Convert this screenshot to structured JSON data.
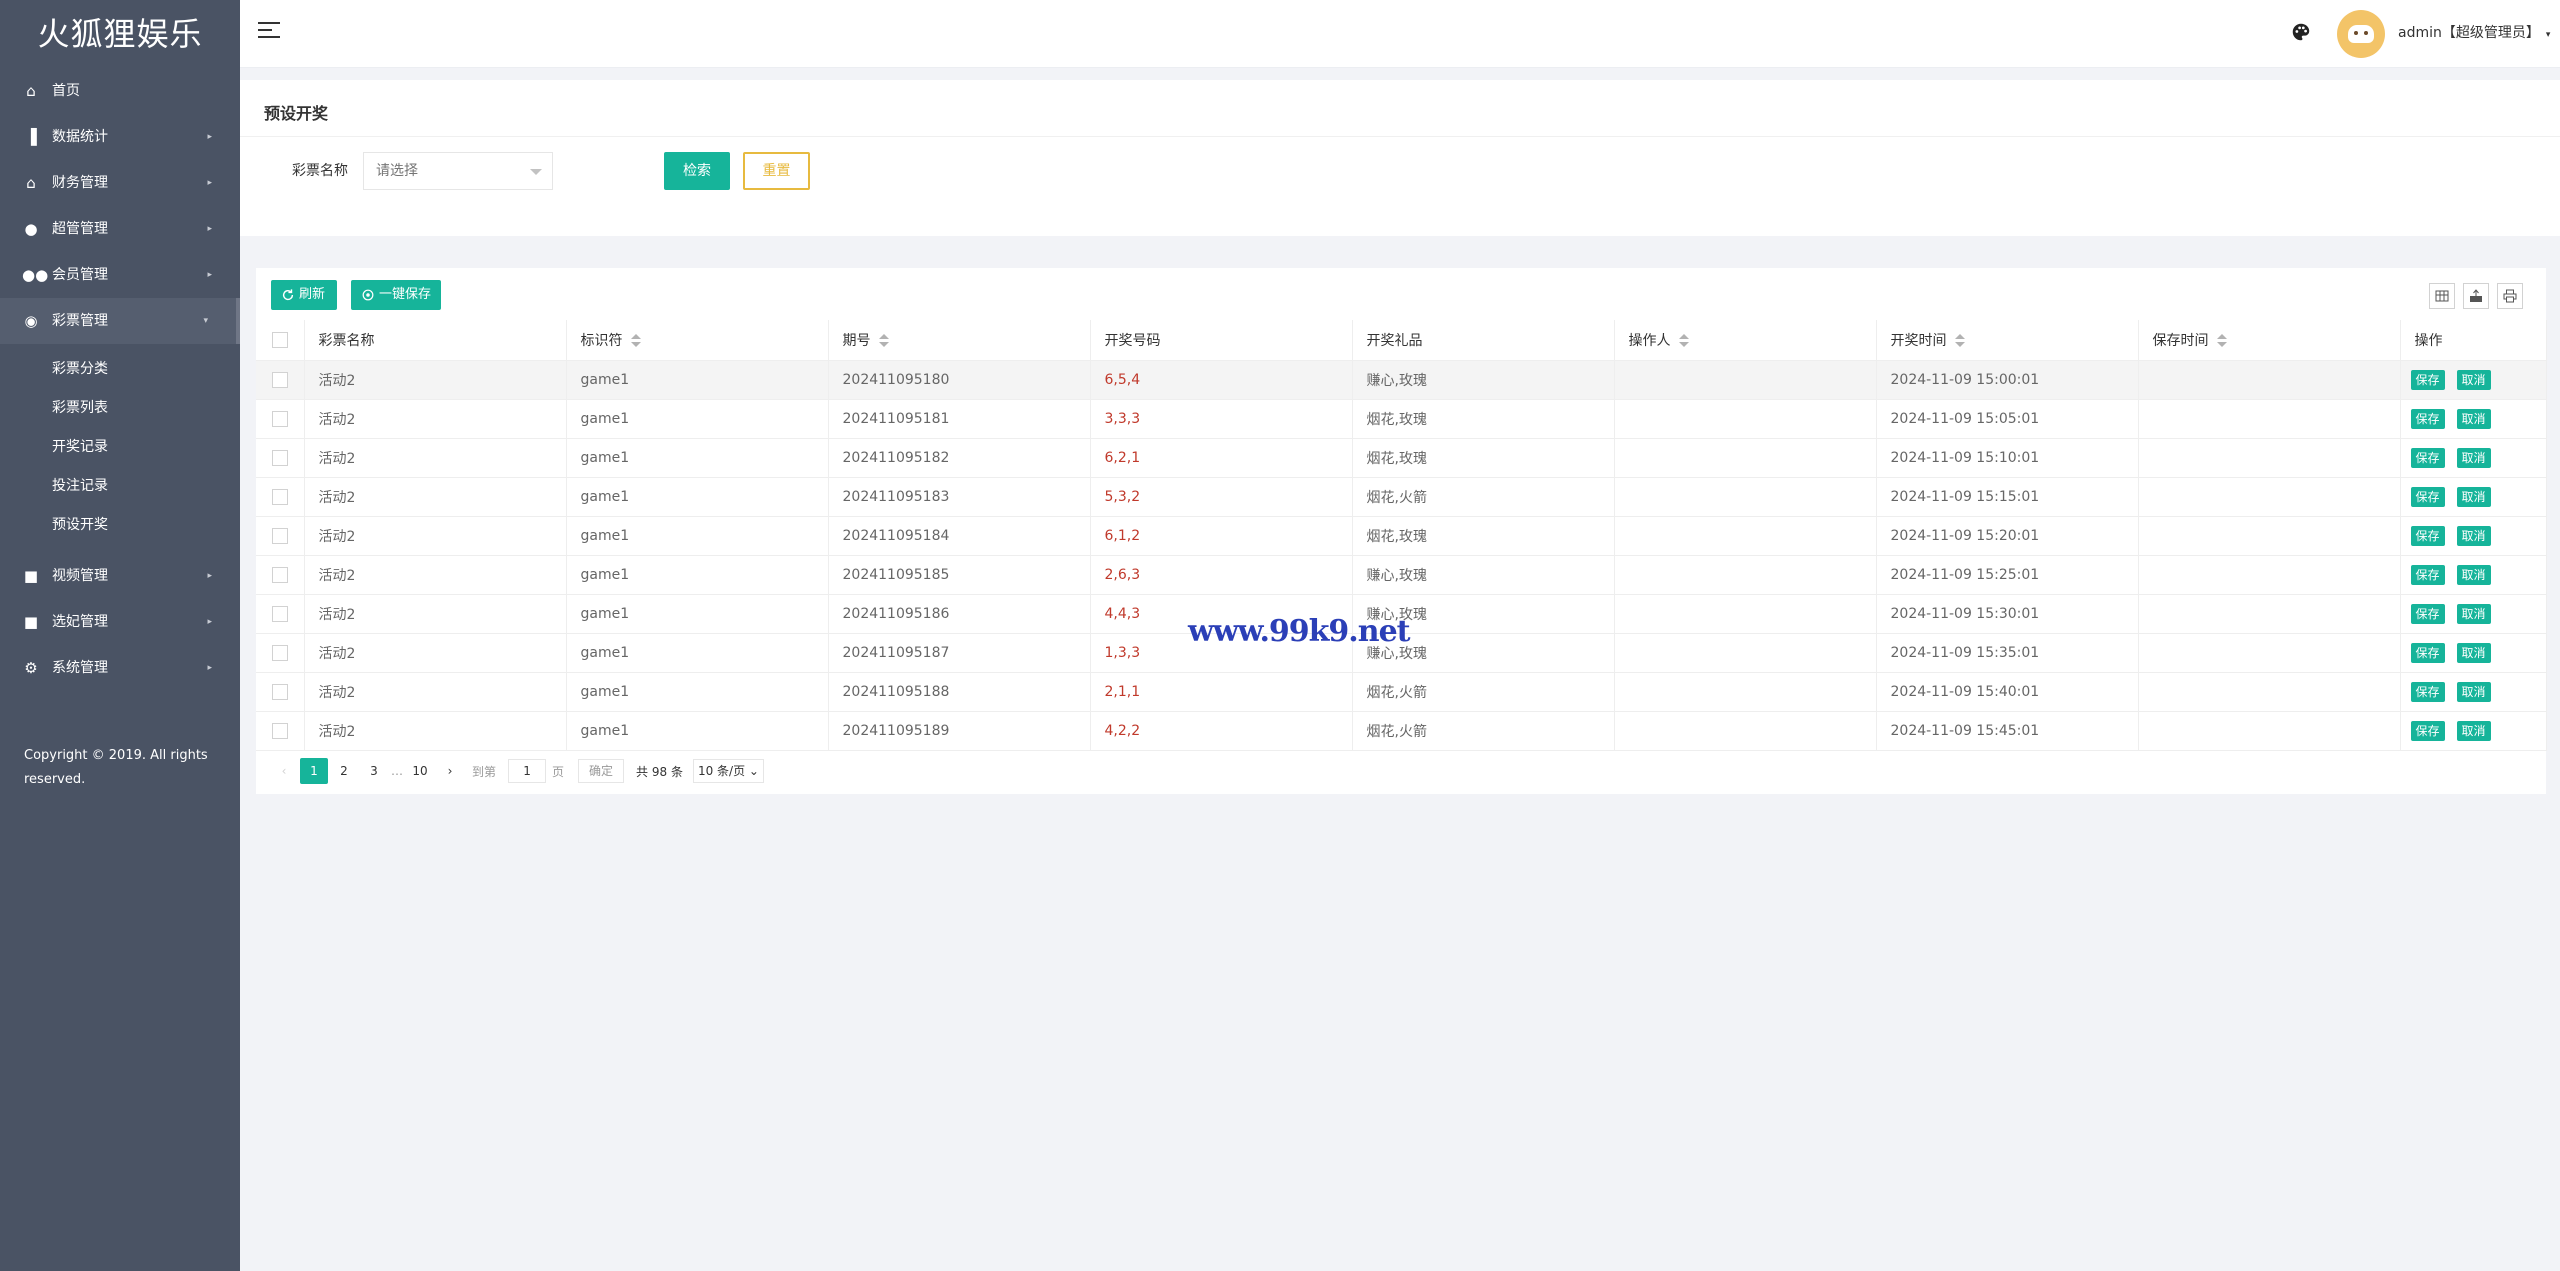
{
  "brand": "火狐狸娱乐",
  "sidebar": {
    "items": [
      {
        "label": "首页",
        "icon": "home-icon",
        "arrow": ""
      },
      {
        "label": "数据统计",
        "icon": "bar-chart-icon",
        "arrow": "▸"
      },
      {
        "label": "财务管理",
        "icon": "bank-icon",
        "arrow": "▸"
      },
      {
        "label": "超管管理",
        "icon": "user-icon",
        "arrow": "▸"
      },
      {
        "label": "会员管理",
        "icon": "users-icon",
        "arrow": "▸"
      },
      {
        "label": "彩票管理",
        "icon": "gamepad-icon",
        "arrow": "▾"
      }
    ],
    "subitems": [
      "彩票分类",
      "彩票列表",
      "开奖记录",
      "投注记录",
      "预设开奖"
    ],
    "items_after": [
      {
        "label": "视频管理",
        "icon": "video-icon",
        "arrow": "▸"
      },
      {
        "label": "选妃管理",
        "icon": "camera-icon",
        "arrow": "▸"
      },
      {
        "label": "系统管理",
        "icon": "gear-icon",
        "arrow": "▸"
      }
    ],
    "copyright": "Copyright © 2019. All rights reserved."
  },
  "header": {
    "user": "admin【超级管理员】",
    "caret": "▾"
  },
  "search": {
    "title": "预设开奖",
    "label": "彩票名称",
    "select_placeholder": "请选择",
    "search_btn": "检索",
    "reset_btn": "重置"
  },
  "toolbar": {
    "refresh": "刷新",
    "save_all": "一键保存"
  },
  "table": {
    "columns": [
      "彩票名称",
      "标识符",
      "期号",
      "开奖号码",
      "开奖礼品",
      "操作人",
      "开奖时间",
      "保存时间",
      "操作"
    ],
    "save_label": "保存",
    "cancel_label": "取消",
    "rows": [
      {
        "name": "活动2",
        "id": "game1",
        "issue": "202411095180",
        "numbers": "6,5,4",
        "gift": "赚心,玫瑰",
        "operator": "",
        "time": "2024-11-09 15:00:01",
        "saved": ""
      },
      {
        "name": "活动2",
        "id": "game1",
        "issue": "202411095181",
        "numbers": "3,3,3",
        "gift": "烟花,玫瑰",
        "operator": "",
        "time": "2024-11-09 15:05:01",
        "saved": ""
      },
      {
        "name": "活动2",
        "id": "game1",
        "issue": "202411095182",
        "numbers": "6,2,1",
        "gift": "烟花,玫瑰",
        "operator": "",
        "time": "2024-11-09 15:10:01",
        "saved": ""
      },
      {
        "name": "活动2",
        "id": "game1",
        "issue": "202411095183",
        "numbers": "5,3,2",
        "gift": "烟花,火箭",
        "operator": "",
        "time": "2024-11-09 15:15:01",
        "saved": ""
      },
      {
        "name": "活动2",
        "id": "game1",
        "issue": "202411095184",
        "numbers": "6,1,2",
        "gift": "烟花,玫瑰",
        "operator": "",
        "time": "2024-11-09 15:20:01",
        "saved": ""
      },
      {
        "name": "活动2",
        "id": "game1",
        "issue": "202411095185",
        "numbers": "2,6,3",
        "gift": "赚心,玫瑰",
        "operator": "",
        "time": "2024-11-09 15:25:01",
        "saved": ""
      },
      {
        "name": "活动2",
        "id": "game1",
        "issue": "202411095186",
        "numbers": "4,4,3",
        "gift": "赚心,玫瑰",
        "operator": "",
        "time": "2024-11-09 15:30:01",
        "saved": ""
      },
      {
        "name": "活动2",
        "id": "game1",
        "issue": "202411095187",
        "numbers": "1,3,3",
        "gift": "赚心,玫瑰",
        "operator": "",
        "time": "2024-11-09 15:35:01",
        "saved": ""
      },
      {
        "name": "活动2",
        "id": "game1",
        "issue": "202411095188",
        "numbers": "2,1,1",
        "gift": "烟花,火箭",
        "operator": "",
        "time": "2024-11-09 15:40:01",
        "saved": ""
      },
      {
        "name": "活动2",
        "id": "game1",
        "issue": "202411095189",
        "numbers": "4,2,2",
        "gift": "烟花,火箭",
        "operator": "",
        "time": "2024-11-09 15:45:01",
        "saved": ""
      }
    ]
  },
  "pagination": {
    "pages": [
      "1",
      "2",
      "3",
      "…",
      "10"
    ],
    "goto_label": "到第",
    "page_value": "1",
    "page_unit": "页",
    "confirm": "确定",
    "total": "共 98 条",
    "page_size": "10 条/页"
  },
  "watermark": "www.99k9.net",
  "colors": {
    "accent": "#16b49a",
    "sidebar": "#4a5364",
    "reset": "#e7ba3f",
    "number": "#c0392b"
  }
}
